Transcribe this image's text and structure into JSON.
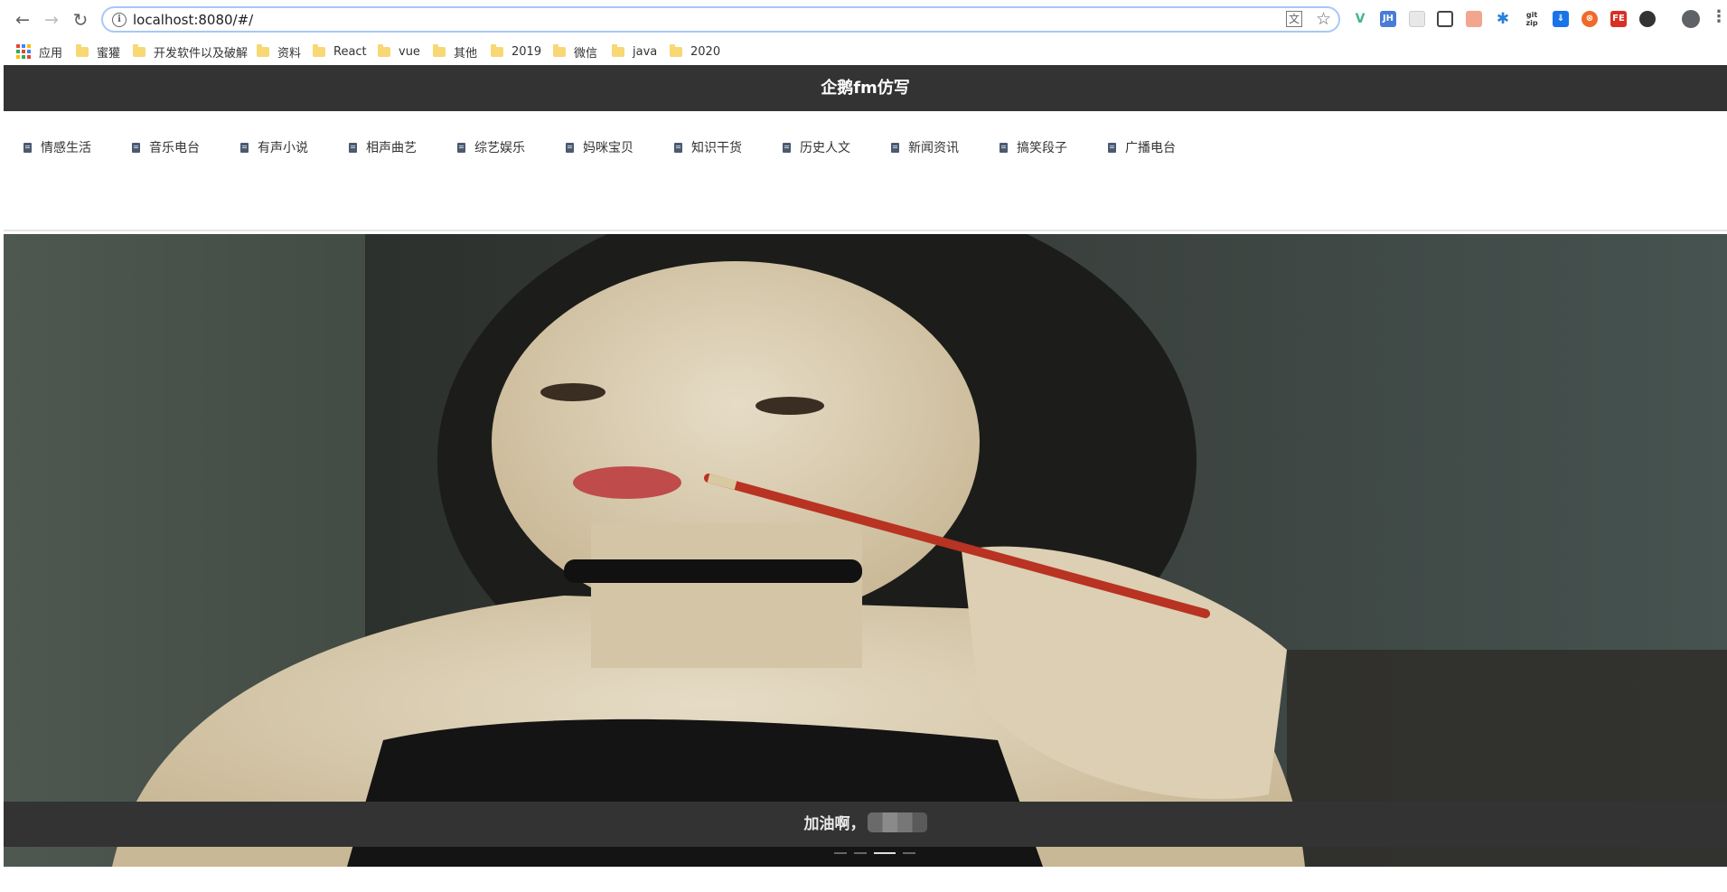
{
  "browser": {
    "url": "localhost:8080/#/",
    "back_glyph": "←",
    "forward_glyph": "→",
    "reload_glyph": "↻",
    "menu_glyph": "⋮",
    "star_glyph": "☆",
    "info_glyph": "i",
    "extensions": [
      "vue-devtools-icon",
      "jh-icon",
      "extension-icon",
      "qr-icon",
      "extension-icon",
      "asterisk-icon",
      "gitzip-icon",
      "download-icon",
      "circle-icon",
      "fe-icon",
      "blob-icon"
    ]
  },
  "bookmarks": {
    "apps_label": "应用",
    "items": [
      "蜜獾",
      "开发软件以及破解",
      "资料",
      "React",
      "vue",
      "其他",
      "2019",
      "微信",
      "java",
      "2020"
    ]
  },
  "app": {
    "title": "企鹅fm仿写",
    "tabs": [
      "情感生活",
      "音乐电台",
      "有声小说",
      "相声曲艺",
      "综艺娱乐",
      "妈咪宝贝",
      "知识干货",
      "历史人文",
      "新闻资讯",
      "搞笑段子",
      "广播电台"
    ],
    "carousel": {
      "slide_count": 4,
      "active_index": 2
    },
    "footer_text": "加油啊，"
  }
}
